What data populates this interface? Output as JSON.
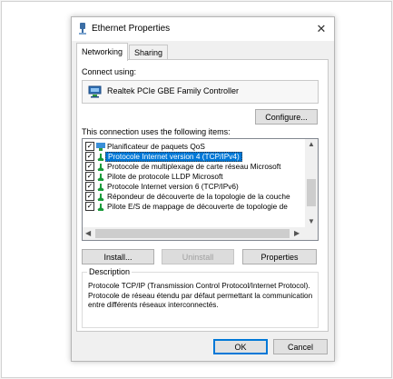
{
  "window": {
    "title": "Ethernet Properties",
    "close_glyph": "✕"
  },
  "tabs": [
    {
      "label": "Networking",
      "active": true
    },
    {
      "label": "Sharing",
      "active": false
    }
  ],
  "connect_using_label": "Connect using:",
  "adapter": {
    "name": "Realtek PCIe GBE Family Controller",
    "icon": "network-adapter-icon"
  },
  "configure_button": "Configure...",
  "items_label": "This connection uses the following items:",
  "items": [
    {
      "label": "Planificateur de paquets QoS",
      "checked": true,
      "selected": false,
      "icon": "qos-scheduler-icon"
    },
    {
      "label": "Protocole Internet version 4 (TCP/IPv4)",
      "checked": true,
      "selected": true,
      "icon": "protocol-icon"
    },
    {
      "label": "Protocole de multiplexage de carte réseau Microsoft",
      "checked": true,
      "selected": false,
      "icon": "protocol-icon"
    },
    {
      "label": "Pilote de protocole LLDP Microsoft",
      "checked": true,
      "selected": false,
      "icon": "protocol-icon"
    },
    {
      "label": "Protocole Internet version 6 (TCP/IPv6)",
      "checked": true,
      "selected": false,
      "icon": "protocol-icon"
    },
    {
      "label": "Répondeur de découverte de la topologie de la couche",
      "checked": true,
      "selected": false,
      "icon": "protocol-icon"
    },
    {
      "label": "Pilote E/S de mappage de découverte de topologie de",
      "checked": true,
      "selected": false,
      "icon": "protocol-icon"
    }
  ],
  "buttons": {
    "install": "Install...",
    "uninstall": "Uninstall",
    "properties": "Properties",
    "ok": "OK",
    "cancel": "Cancel"
  },
  "description": {
    "legend": "Description",
    "text": "Protocole TCP/IP (Transmission Control Protocol/Internet Protocol). Protocole de réseau étendu par défaut permettant la communication entre différents réseaux interconnectés."
  },
  "colors": {
    "accent": "#0078d7",
    "protocol_icon": "#1a9a3a",
    "window_bg": "#f0f0f0"
  }
}
